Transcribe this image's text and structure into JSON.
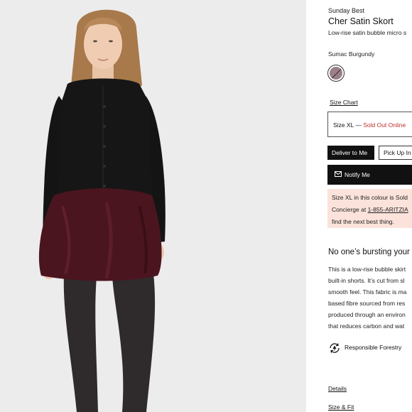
{
  "product": {
    "brand": "Sunday Best",
    "name": "Cher Satin Skort",
    "subtitle": "Low-rise satin bubble micro s",
    "colour_name": "Sumac Burgundy",
    "swatch_color": "#9a8088"
  },
  "size": {
    "chart_link": "Size Chart",
    "selected": "Size XL",
    "separator": " — ",
    "status": "Sold Out Online",
    "status_color": "#c0312b"
  },
  "delivery": {
    "deliver_label": "Deliver to Me",
    "pickup_label": "Pick Up In"
  },
  "notify": {
    "label": "Notify Me",
    "icon": "mail-icon"
  },
  "notice": {
    "line1": "Size XL in this colour is Sold",
    "line2_prefix": "Concierge at ",
    "phone": "1-855-ARITZIA",
    "line3": "find the next best thing.",
    "bg_color": "#fbe3db"
  },
  "description": {
    "headline": "No one’s bursting your",
    "lines": [
      "This is a low-rise bubble skirt",
      "built-in shorts. It’s cut from sl",
      "smooth feel. This fabric is ma",
      "based fibre sourced from res",
      "produced through an environ",
      "that reduces carbon and wat"
    ]
  },
  "sustainability": {
    "label": "Responsible Forestry",
    "icon": "responsible-forestry-icon"
  },
  "links": {
    "details": "Details",
    "size_fit": "Size & Fit"
  }
}
